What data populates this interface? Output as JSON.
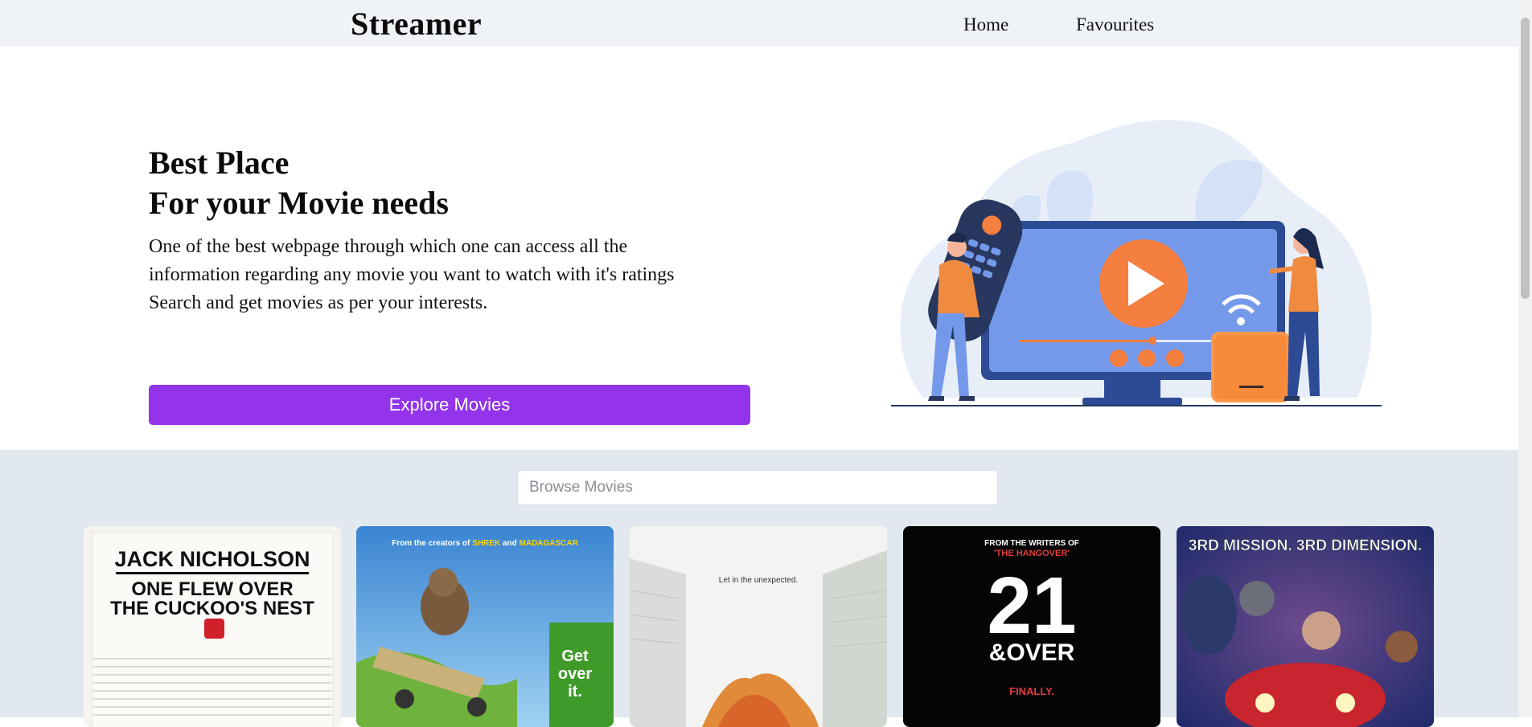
{
  "nav": {
    "brand": "Streamer",
    "links": [
      "Home",
      "Favourites"
    ]
  },
  "hero": {
    "title_line1": "Best Place",
    "title_line2": "For your Movie needs",
    "description": "One of the best webpage through which one can access all the\ninformation regarding any movie you want to watch with it's ratings\nSearch and get movies as per your interests.",
    "explore_label": "Explore Movies",
    "accent_color": "#9333ea"
  },
  "browse": {
    "search_placeholder": "Browse Movies"
  },
  "posters": [
    {
      "line1": "JACK NICHOLSON",
      "line2": "ONE FLEW OVER",
      "line3": "THE CUCKOO'S NEST"
    },
    {
      "tagline": "From the creators of SHREK and MADAGASCAR",
      "tagline_creators": "From the creators of",
      "tagline_shrek": "SHREK",
      "tagline_and": "and",
      "tagline_madagascar": "MADAGASCAR",
      "line1": "Get",
      "line2": "over",
      "line3": "it."
    },
    {
      "tagline": "Let in the unexpected."
    },
    {
      "tagline_top": "FROM THE WRITERS OF",
      "tagline_sub": "'THE HANGOVER'",
      "big1": "21",
      "big2": "&OVER",
      "bottom": "FINALLY."
    },
    {
      "tagline": "3RD MISSION. 3RD DIMENSION."
    }
  ]
}
